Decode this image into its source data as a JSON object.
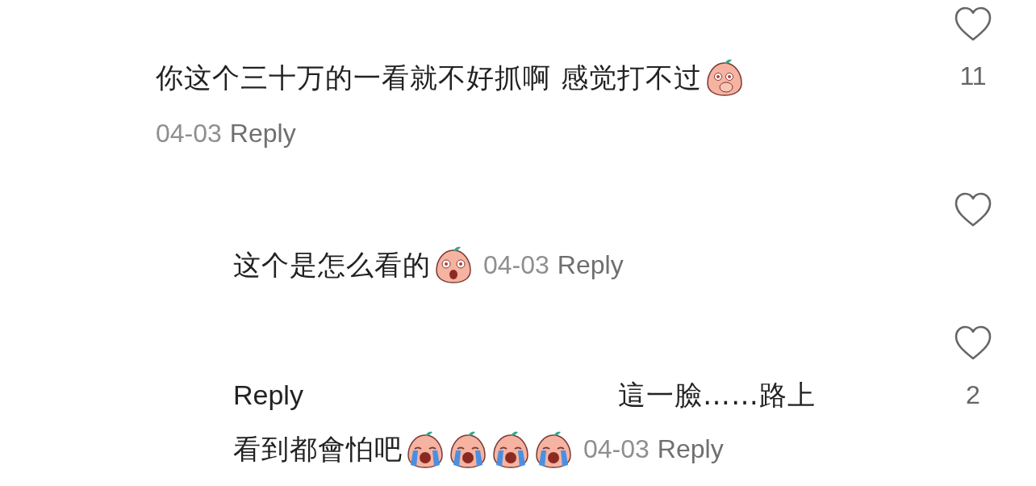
{
  "comments": [
    {
      "kind": "comment",
      "lines": [
        "你这个三十万的一看就不好抓啊 感觉打不过"
      ],
      "emojis": [
        {
          "kind": "covering-mouth"
        }
      ],
      "date": "04-03",
      "reply": "Reply",
      "likes": "11"
    },
    {
      "kind": "reply",
      "lines": [
        "这个是怎么看的"
      ],
      "emojis": [
        {
          "kind": "shocked"
        }
      ],
      "date": "04-03",
      "reply": "Reply"
    },
    {
      "kind": "reply",
      "prefix": "Reply",
      "lines": [
        "這一臉……路上",
        "看到都會怕吧"
      ],
      "emojis": [
        {
          "kind": "crying"
        },
        {
          "kind": "crying"
        },
        {
          "kind": "crying"
        },
        {
          "kind": "crying"
        }
      ],
      "date": "04-03",
      "reply": "Reply",
      "likes": "2"
    }
  ]
}
